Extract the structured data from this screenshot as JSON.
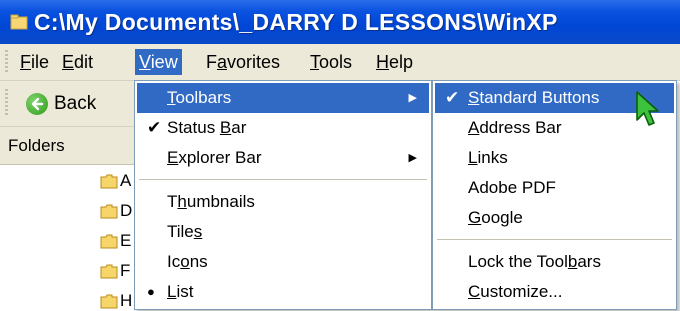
{
  "window": {
    "title": "C:\\My Documents\\_DARRY D LESSONS\\WinXP",
    "title_icon": "folder-window-icon",
    "title_bar_color": "#0a52e0"
  },
  "menubar": {
    "items": [
      {
        "label": "File",
        "state": "normal"
      },
      {
        "label": "Edit",
        "state": "normal"
      },
      {
        "label": "View",
        "state": "open"
      },
      {
        "label": "Favorites",
        "state": "normal"
      },
      {
        "label": "Tools",
        "state": "normal"
      },
      {
        "label": "Help",
        "state": "normal"
      }
    ]
  },
  "toolbar": {
    "back_label": "Back",
    "back_icon": "back-arrow-icon"
  },
  "folders_pane": {
    "header": "Folders",
    "rows": [
      "A",
      "D",
      "E",
      "F",
      "H"
    ]
  },
  "view_menu": {
    "highlight_color": "#316ac5",
    "items": [
      {
        "label": "Toolbars",
        "checked": false,
        "has_submenu": true,
        "highlighted": true
      },
      {
        "label": "Status Bar",
        "checked": true,
        "has_submenu": false,
        "highlighted": false
      },
      {
        "label": "Explorer Bar",
        "checked": false,
        "has_submenu": true,
        "highlighted": false
      },
      {
        "label": "Thumbnails",
        "checked": false,
        "has_submenu": false,
        "highlighted": false
      },
      {
        "label": "Tiles",
        "checked": false,
        "has_submenu": false,
        "highlighted": false
      },
      {
        "label": "Icons",
        "checked": false,
        "has_submenu": false,
        "highlighted": false
      },
      {
        "label": "List",
        "checked": false,
        "selected_radio": true,
        "has_submenu": false,
        "highlighted": false
      }
    ]
  },
  "toolbars_submenu": {
    "items": [
      {
        "label": "Standard Buttons",
        "checked": true,
        "highlighted": true
      },
      {
        "label": "Address Bar",
        "checked": false,
        "highlighted": false
      },
      {
        "label": "Links",
        "checked": false,
        "highlighted": false
      },
      {
        "label": "Adobe PDF",
        "checked": false,
        "highlighted": false
      },
      {
        "label": "Google",
        "checked": false,
        "highlighted": false
      },
      {
        "label": "Lock the Toolbars",
        "checked": false,
        "highlighted": false
      },
      {
        "label": "Customize...",
        "checked": false,
        "highlighted": false
      }
    ]
  },
  "glyphs": {
    "check": "✔",
    "radio": "●",
    "submenu_arrow": "▶"
  },
  "cursor": {
    "icon": "green-pointer-cursor-icon",
    "color": "#3cc23c"
  }
}
